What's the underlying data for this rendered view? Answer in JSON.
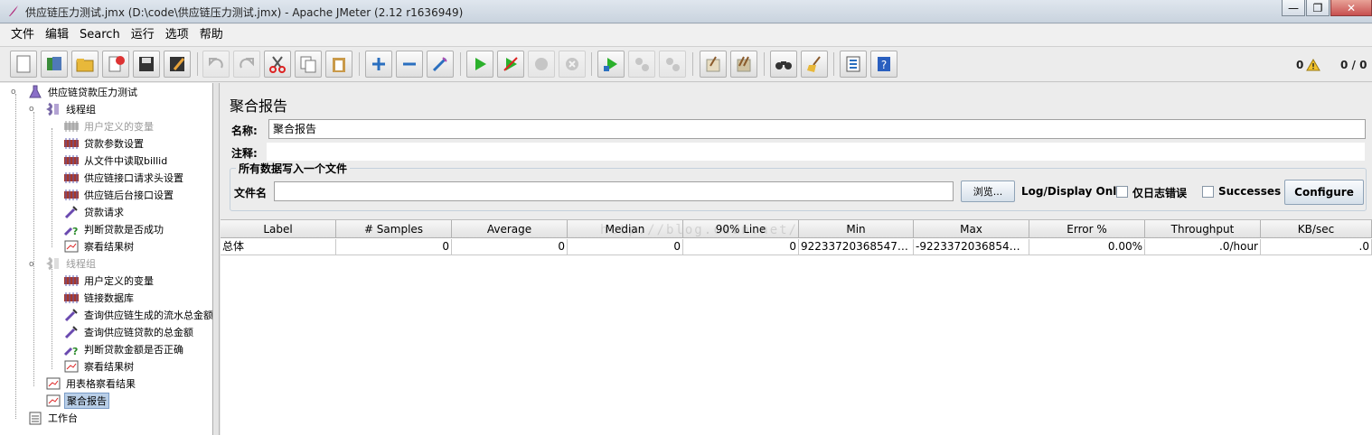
{
  "window": {
    "title": "供应链压力测试.jmx (D:\\code\\供应链压力测试.jmx) - Apache JMeter (2.12 r1636949)",
    "minimize": "—",
    "maximize": "❐",
    "close": "✕"
  },
  "menu": [
    "文件",
    "编辑",
    "Search",
    "运行",
    "选项",
    "帮助"
  ],
  "toolbar": {
    "errors": "0",
    "threads": "0 / 0"
  },
  "tree": {
    "root": "供应链贷款压力测试",
    "group1": "线程组",
    "g1_items": [
      "用户定义的变量",
      "贷款参数设置",
      "从文件中读取billid",
      "供应链接口请求头设置",
      "供应链后台接口设置",
      "贷款请求",
      "判断贷款是否成功",
      "察看结果树"
    ],
    "group2": "线程组",
    "g2_items": [
      "用户定义的变量",
      "链接数据库",
      "查询供应链生成的流水总金额",
      "查询供应链贷款的总金额",
      "判断贷款金额是否正确",
      "察看结果树"
    ],
    "table_view": "用表格察看结果",
    "aggregate": "聚合报告",
    "workbench": "工作台"
  },
  "panel": {
    "title": "聚合报告",
    "name_label": "名称:",
    "name_value": "聚合报告",
    "comment_label": "注释:",
    "comment_value": "",
    "file_group_title": "所有数据写入一个文件",
    "file_label": "文件名",
    "file_value": "",
    "browse_button": "浏览...",
    "log_display_label": "Log/Display Only:",
    "errors_only_label": "仅日志错误",
    "successes_label": "Successes",
    "configure_button": "Configure"
  },
  "table": {
    "watermark": "http://blog.csdn.net/",
    "columns": [
      "Label",
      "# Samples",
      "Average",
      "Median",
      "90% Line",
      "Min",
      "Max",
      "Error %",
      "Throughput",
      "KB/sec"
    ],
    "rows": [
      [
        "总体",
        "0",
        "0",
        "0",
        "0",
        "9223372036854775...",
        "-9223372036854775...",
        "0.00%",
        ".0/hour",
        ".0"
      ]
    ]
  }
}
